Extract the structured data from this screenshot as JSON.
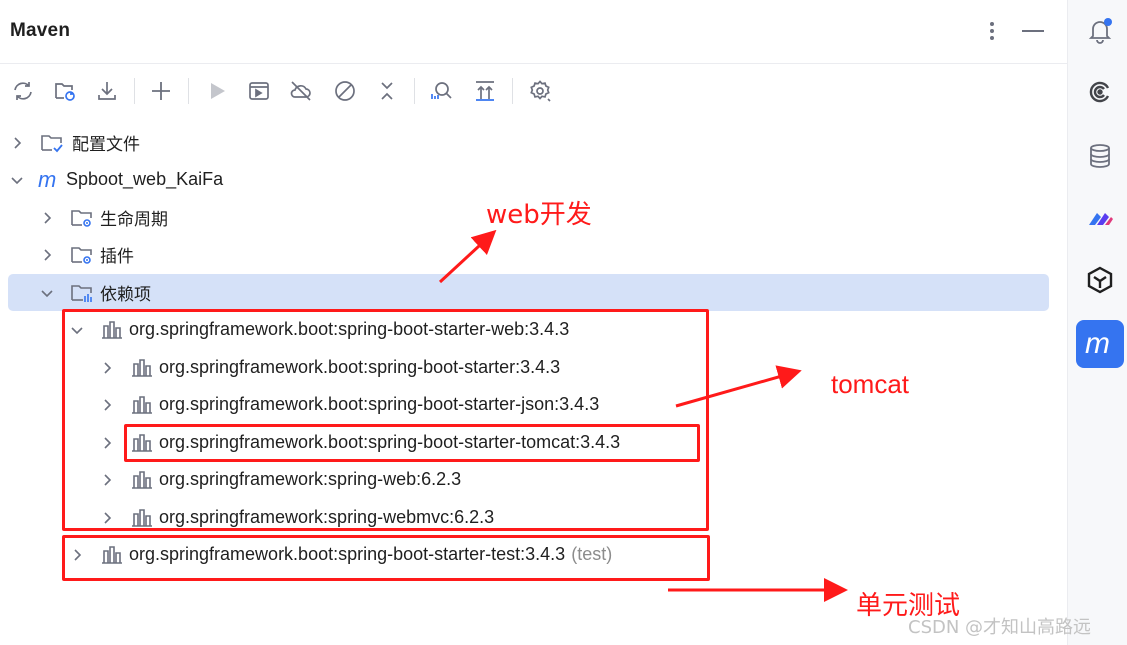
{
  "panel": {
    "title": "Maven",
    "header_icons": [
      "more-vertical-icon",
      "minimize-icon"
    ]
  },
  "toolbar": {
    "buttons": [
      {
        "name": "reload-all-projects-icon"
      },
      {
        "name": "reload-folder-icon"
      },
      {
        "name": "download-sources-icon"
      },
      {
        "name": "add-project-icon"
      },
      {
        "name": "run-icon"
      },
      {
        "name": "execute-goal-icon"
      },
      {
        "name": "offline-mode-icon"
      },
      {
        "name": "skip-tests-icon"
      },
      {
        "name": "collapse-all-icon"
      },
      {
        "name": "analyze-dependencies-icon"
      },
      {
        "name": "show-dependencies-icon"
      },
      {
        "name": "settings-icon"
      }
    ]
  },
  "tree": {
    "config_files": "配置文件",
    "project": "Spboot_web_KaiFa",
    "lifecycle": "生命周期",
    "plugins": "插件",
    "dependencies": "依赖项",
    "dep_web": "org.springframework.boot:spring-boot-starter-web:3.4.3",
    "dep_starter": "org.springframework.boot:spring-boot-starter:3.4.3",
    "dep_json": "org.springframework.boot:spring-boot-starter-json:3.4.3",
    "dep_tomcat": "org.springframework.boot:spring-boot-starter-tomcat:3.4.3",
    "dep_spring_web": "org.springframework:spring-web:6.2.3",
    "dep_webmvc": "org.springframework:spring-webmvc:6.2.3",
    "dep_test": "org.springframework.boot:spring-boot-starter-test:3.4.3",
    "dep_test_scope": "(test)"
  },
  "annotations": {
    "web": "web开发",
    "tomcat": "tomcat",
    "test": "单元测试",
    "color": "#ff1a1a"
  },
  "right_strip": {
    "icons": [
      "notifications-icon",
      "ai-assistant-icon",
      "database-icon",
      "plugin-marketplace-icon",
      "copilot-icon",
      "maven-icon"
    ]
  },
  "watermark": "CSDN @才知山高路远",
  "colors": {
    "selection": "#d5e1f8",
    "accent": "#3574f0"
  }
}
